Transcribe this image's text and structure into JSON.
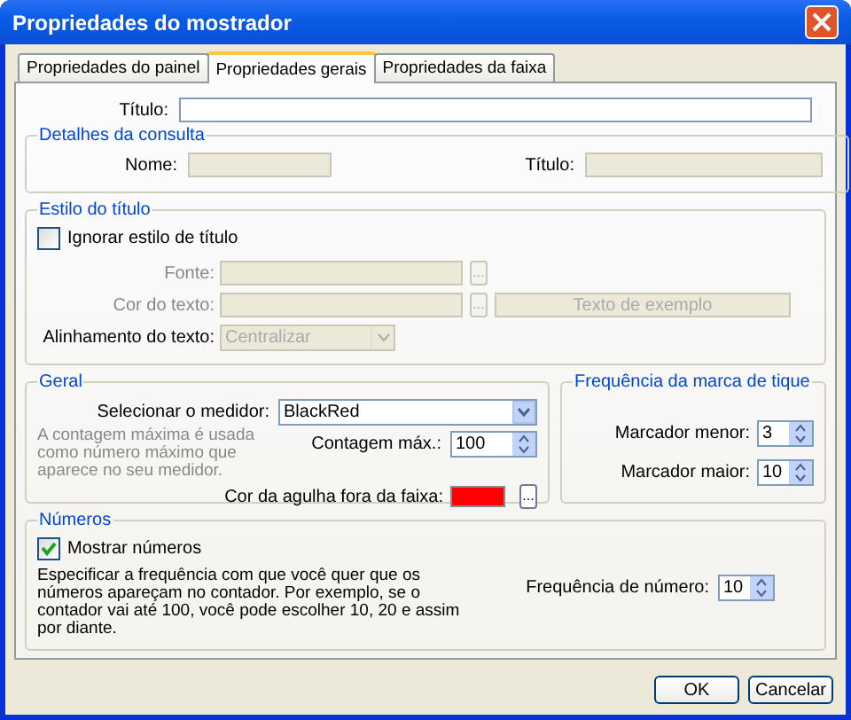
{
  "window": {
    "title": "Propriedades do mostrador"
  },
  "tabs": [
    {
      "label": "Propriedades do painel",
      "selected": false
    },
    {
      "label": "Propriedades gerais",
      "selected": true
    },
    {
      "label": "Propriedades da faixa",
      "selected": false
    }
  ],
  "title_field": {
    "label": "Título:"
  },
  "query_details": {
    "legend": "Detalhes da consulta",
    "fields": [
      {
        "label": "Nome:",
        "disabled": true
      },
      {
        "label": "Título:",
        "disabled": true
      }
    ]
  },
  "title_style": {
    "legend": "Estilo do título",
    "ignore": {
      "label": "Ignorar estilo de título",
      "checked": false
    },
    "font": {
      "label": "Fonte:",
      "disabled": true,
      "browse": "..."
    },
    "text_color": {
      "label": "Cor do texto:",
      "disabled": true,
      "browse": "...",
      "sample": "Texto de exemplo"
    },
    "alignment": {
      "label": "Alinhamento do texto:",
      "value": "Centralizar",
      "disabled": true
    }
  },
  "general": {
    "legend": "Geral",
    "meter": {
      "label": "Selecionar o medidor:",
      "value": "BlackRed"
    },
    "help": "A contagem máxima é usada como número máximo que aparece no seu medidor.",
    "max_count": {
      "label": "Contagem máx.:",
      "value": "100"
    },
    "needle_color": {
      "label": "Cor da agulha fora da faixa:",
      "color": "#ff0000",
      "browse": "..."
    }
  },
  "tick_frequency": {
    "legend": "Frequência da marca de tique",
    "spinners": [
      {
        "label": "Marcador menor:",
        "value": "3"
      },
      {
        "label": "Marcador maior:",
        "value": "10"
      }
    ]
  },
  "numbers": {
    "legend": "Números",
    "show": {
      "label": "Mostrar números",
      "checked": true
    },
    "help": "Especificar a frequência com que você quer que os números apareçam no contador. Por exemplo, se o contador vai até 100, você pode escolher 10, 20 e assim por diante.",
    "frequency": {
      "label": "Frequência de número:",
      "value": "10"
    }
  },
  "buttons": [
    "OK",
    "Cancelar"
  ]
}
